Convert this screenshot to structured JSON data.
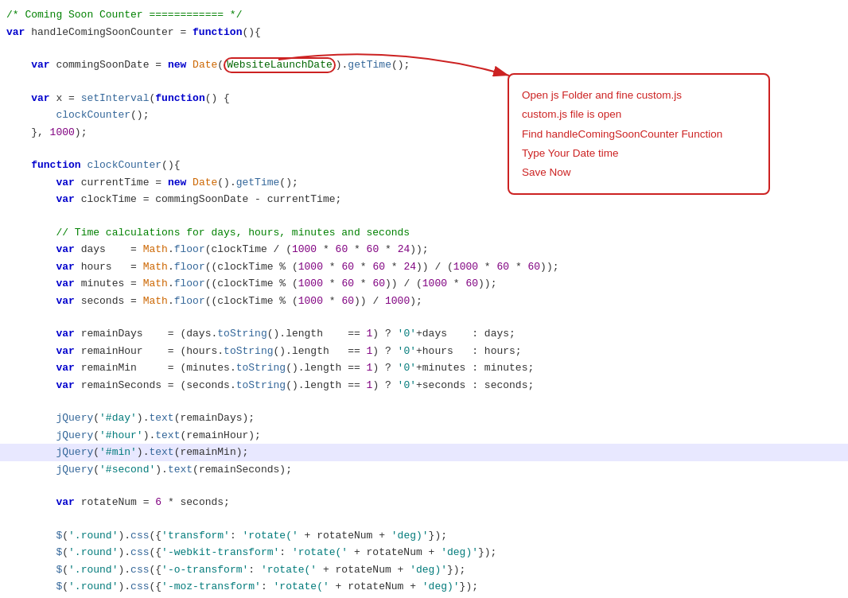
{
  "title": "Coming Soon Counter",
  "callout": {
    "line1": "Open js Folder and fine custom.js",
    "line2": "custom.js file is open",
    "line3": "Find handleComingSoonCounter Function",
    "line4": "Type Your Date time",
    "line5": "Save Now"
  },
  "code_lines": [
    {
      "id": 1,
      "highlighted": false
    },
    {
      "id": 2,
      "highlighted": false
    },
    {
      "id": 3,
      "highlighted": false
    },
    {
      "id": 4,
      "highlighted": false
    },
    {
      "id": 5,
      "highlighted": false
    },
    {
      "id": 6,
      "highlighted": false
    },
    {
      "id": 7,
      "highlighted": false
    }
  ]
}
